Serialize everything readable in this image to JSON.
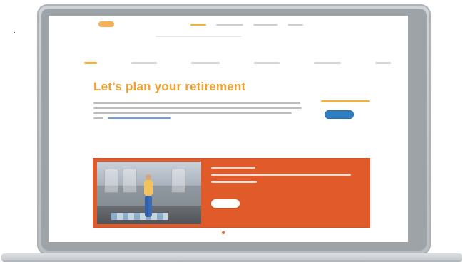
{
  "page": {
    "title": "Let’s plan your retirement"
  },
  "colors": {
    "accent_orange": "#f0a12d",
    "hero_orange": "#e05a2a",
    "link_blue": "#6ea1d8",
    "button_blue": "#2f7ec2",
    "screen_white": "#ffffff"
  },
  "icons": {
    "tiny_mark": "small-mark-icon"
  }
}
